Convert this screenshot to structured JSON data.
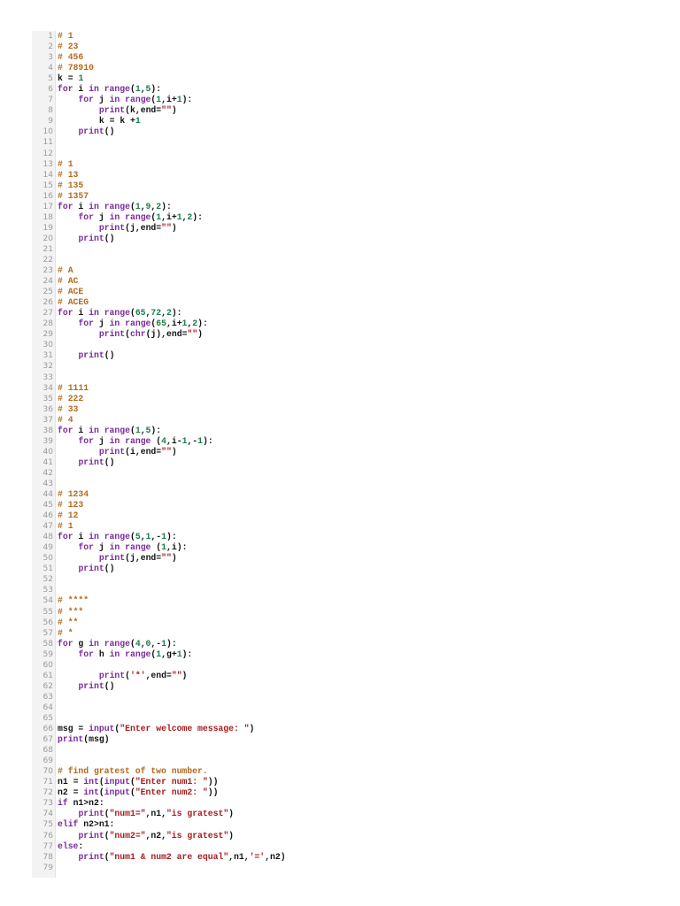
{
  "colors": {
    "keyword": "#7b2a9c",
    "number": "#1b7a4a",
    "comment": "#b36a1c",
    "string": "#a51c1c",
    "text": "#111111"
  },
  "lines": [
    "# 1",
    "# 23",
    "# 456",
    "# 78910",
    "k = 1",
    "for i in range(1,5):",
    "    for j in range(1,i+1):",
    "        print(k,end=\"\")",
    "        k = k +1",
    "    print()",
    "",
    "",
    "# 1",
    "# 13",
    "# 135",
    "# 1357",
    "for i in range(1,9,2):",
    "    for j in range(1,i+1,2):",
    "        print(j,end=\"\")",
    "    print()",
    "",
    "",
    "# A",
    "# AC",
    "# ACE",
    "# ACEG",
    "for i in range(65,72,2):",
    "    for j in range(65,i+1,2):",
    "        print(chr(j),end=\"\")",
    "",
    "    print()",
    "",
    "",
    "# 1111",
    "# 222",
    "# 33",
    "# 4",
    "for i in range(1,5):",
    "    for j in range (4,i-1,-1):",
    "        print(i,end=\"\")",
    "    print()",
    "",
    "",
    "# 1234",
    "# 123",
    "# 12",
    "# 1",
    "for i in range(5,1,-1):",
    "    for j in range (1,i):",
    "        print(j,end=\"\")",
    "    print()",
    "",
    "",
    "# ****",
    "# ***",
    "# **",
    "# *",
    "for g in range(4,0,-1):",
    "    for h in range(1,g+1):",
    "",
    "        print('*',end=\"\")",
    "    print()",
    "",
    "",
    "",
    "msg = input(\"Enter welcome message: \")",
    "print(msg)",
    "",
    "",
    "# find gratest of two number.",
    "n1 = int(input(\"Enter num1: \"))",
    "n2 = int(input(\"Enter num2: \"))",
    "if n1>n2:",
    "    print(\"num1=\",n1,\"is gratest\")",
    "elif n2>n1:",
    "    print(\"num2=\",n2,\"is gratest\")",
    "else:",
    "    print(\"num1 & num2 are equal\",n1,'=',n2)",
    ""
  ]
}
